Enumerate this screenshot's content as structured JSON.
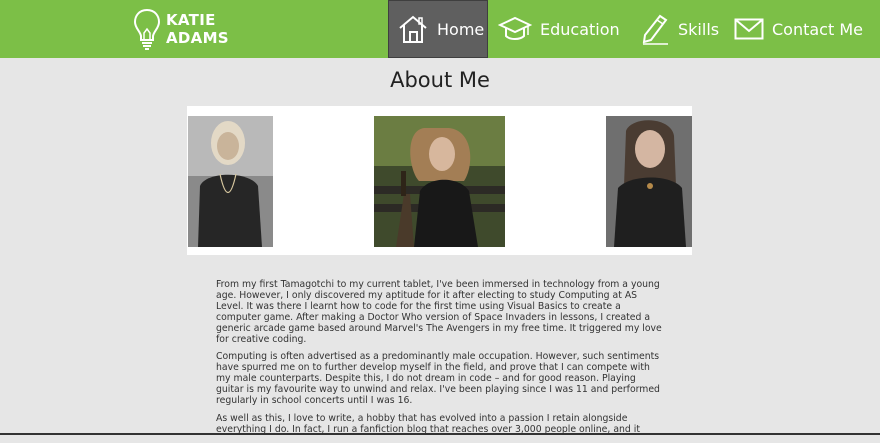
{
  "brand": {
    "line1": "KATIE",
    "line2": "ADAMS"
  },
  "nav": [
    {
      "label": "Home",
      "icon": "house-icon",
      "active": true
    },
    {
      "label": "Education",
      "icon": "graduation-cap-icon",
      "active": false
    },
    {
      "label": "Skills",
      "icon": "pencil-icon",
      "active": false
    },
    {
      "label": "Contact Me",
      "icon": "envelope-icon",
      "active": false
    }
  ],
  "page": {
    "title": "About Me"
  },
  "colors": {
    "nav_bg": "#7cbf47",
    "active_bg": "#5f5f5f",
    "page_bg": "#e6e6e6"
  },
  "about": {
    "paragraphs": [
      "From my first Tamagotchi to my current tablet, I've been immersed in technology from a young age. However, I only discovered my aptitude for it after electing to study Computing at AS Level. It was there I learnt how to code for the first time using Visual Basics to create a computer game. After making a Doctor Who version of Space Invaders in lessons, I created a generic arcade game based around Marvel's The Avengers in my free time. It triggered my love for creative coding.",
      "Computing is often advertised as a predominantly male occupation. However, such sentiments have spurred me on to further develop myself in the field, and prove that I can compete with my male counterparts. Despite this, I do not dream in code – and for good reason. Playing guitar is my favourite way to unwind and relax. I've been playing since I was 11 and performed regularly in school concerts until I was 16.",
      "As well as this, I love to write, a hobby that has evolved into a passion I retain alongside everything I do. In fact, I run a fanfiction blog that reaches over 3,000 people online, and it"
    ]
  }
}
